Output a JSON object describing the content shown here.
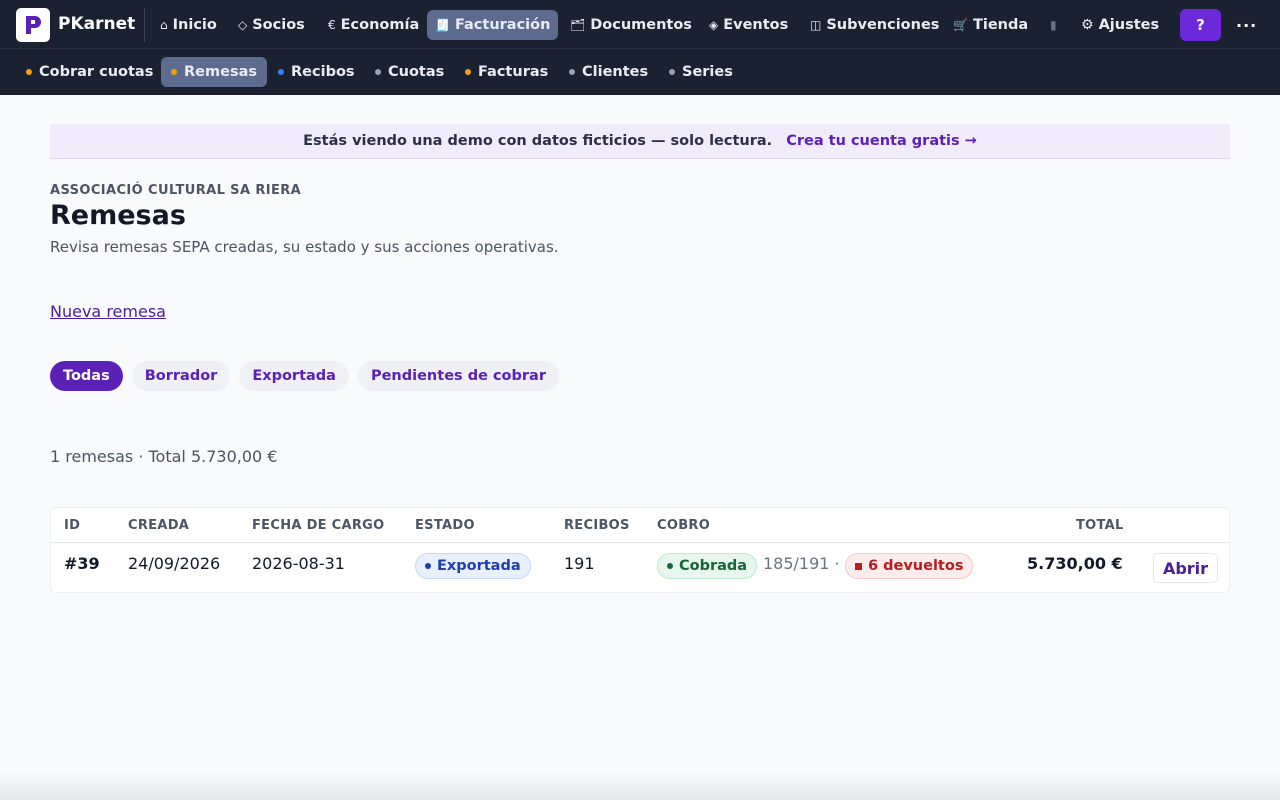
{
  "app": {
    "brand": "PKarnet",
    "logo_icon": "pkarnet-logo-icon"
  },
  "topnav": {
    "items": [
      {
        "label": "Inicio",
        "icon": "home-icon",
        "glyph": "⌂"
      },
      {
        "label": "Socios",
        "icon": "diamond-icon",
        "glyph": "◇"
      },
      {
        "label": "Economía",
        "icon": "euro-icon",
        "glyph": "€"
      },
      {
        "label": "Facturación",
        "icon": "invoice-icon",
        "glyph": "🧾",
        "active": true
      },
      {
        "label": "Documentos",
        "icon": "folder-icon",
        "glyph": "🗂"
      },
      {
        "label": "Eventos",
        "icon": "event-diamond-icon",
        "glyph": "◈"
      },
      {
        "label": "Subvenciones",
        "icon": "grants-icon",
        "glyph": "◫"
      },
      {
        "label": "Tienda",
        "icon": "cart-icon",
        "glyph": "🛒"
      },
      {
        "label": "",
        "icon": "fade-block-icon",
        "glyph": "▮"
      },
      {
        "label": "Ajustes",
        "icon": "gear-icon",
        "glyph": "⚙"
      }
    ],
    "help_label": "?",
    "more_label": "..."
  },
  "subnav": {
    "items": [
      {
        "label": "Cobrar cuotas",
        "dot_color": "#f59e0b"
      },
      {
        "label": "Remesas",
        "dot_color": "#f59e0b",
        "active": true
      },
      {
        "label": "Recibos",
        "dot_color": "#3b82f6"
      },
      {
        "label": "Cuotas",
        "dot_color": "#9ca3af"
      },
      {
        "label": "Facturas",
        "dot_color": "#f59e0b"
      },
      {
        "label": "Clientes",
        "dot_color": "#9ca3af"
      },
      {
        "label": "Series",
        "dot_color": "#9ca3af"
      }
    ]
  },
  "banner": {
    "text": "Estás viendo una demo con datos ficticios — solo lectura.",
    "link": "Crea tu cuenta gratis →"
  },
  "page": {
    "org": "ASSOCIACIÓ CULTURAL SA RIERA",
    "title": "Remesas",
    "subtitle": "Revisa remesas SEPA creadas, su estado y sus acciones operativas.",
    "new_link": "Nueva remesa"
  },
  "filters": [
    {
      "label": "Todas",
      "active": true
    },
    {
      "label": "Borrador"
    },
    {
      "label": "Exportada"
    },
    {
      "label": "Pendientes de cobrar"
    }
  ],
  "summary": "1 remesas · Total 5.730,00 €",
  "table": {
    "headers": {
      "id": "ID",
      "created": "CREADA",
      "charge_date": "FECHA DE CARGO",
      "status": "ESTADO",
      "receipts": "RECIBOS",
      "collection": "COBRO",
      "total": "TOTAL"
    },
    "rows": [
      {
        "id": "#39",
        "created": "24/09/2026",
        "charge_date": "2026-08-31",
        "status": "Exportada",
        "receipts": "191",
        "collection_status": "Cobrada",
        "collection_ratio": "185/191 ·",
        "returned": "6 devueltos",
        "total": "5.730,00 €",
        "action": "Abrir"
      }
    ]
  },
  "colors": {
    "nav_bg": "#1a2130",
    "accent": "#5b21b6",
    "active_tab": "#5d6b8f"
  }
}
